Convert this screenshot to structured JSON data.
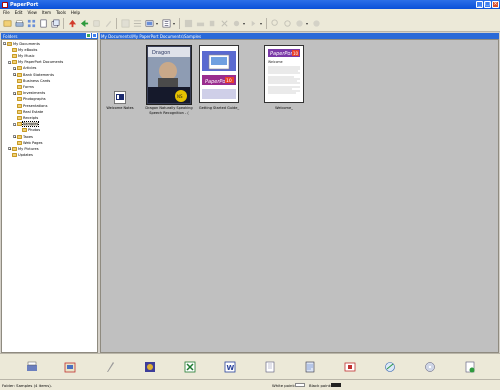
{
  "window": {
    "title": "PaperPort"
  },
  "menu": [
    "File",
    "Edit",
    "View",
    "Item",
    "Tools",
    "Help"
  ],
  "folders_panel": {
    "title": "Folders",
    "tree": [
      {
        "label": "My Documents",
        "expander": "−"
      },
      {
        "label": "My eBooks",
        "expander": ""
      },
      {
        "label": "My Music",
        "expander": ""
      },
      {
        "label": "My PaperPort Documents",
        "expander": "−"
      },
      {
        "label": "Articles",
        "expander": "+"
      },
      {
        "label": "Bank Statements",
        "expander": "+"
      },
      {
        "label": "Business Cards",
        "expander": ""
      },
      {
        "label": "Forms",
        "expander": ""
      },
      {
        "label": "Investments",
        "expander": "+"
      },
      {
        "label": "Photographs",
        "expander": ""
      },
      {
        "label": "Presentations",
        "expander": ""
      },
      {
        "label": "Real Estate",
        "expander": ""
      },
      {
        "label": "Receipts",
        "expander": ""
      },
      {
        "label": "Samples",
        "expander": "−"
      },
      {
        "label": "Photos",
        "expander": ""
      },
      {
        "label": "Taxes",
        "expander": "+"
      },
      {
        "label": "Web Pages",
        "expander": ""
      },
      {
        "label": "My Pictures",
        "expander": "+"
      },
      {
        "label": "Updates",
        "expander": ""
      }
    ],
    "selected": "Samples"
  },
  "path": "My Documents\\My PaperPort Documents\\Samples",
  "items": [
    {
      "caption": "Welcome Notes"
    },
    {
      "caption": "Dragon Naturally Speaking Speech Recognition - ("
    },
    {
      "caption": "Getting Started Guide_"
    },
    {
      "caption": "Welcome_"
    }
  ],
  "doc_text": {
    "brand": "PaperPort",
    "version": "10",
    "welcome": "Welcome",
    "dragon_brand": "Dragon",
    "ns_mark": "NS"
  },
  "send_to_apps": [
    {
      "icon": "scanner-app-icon"
    },
    {
      "icon": "fax-app-icon"
    },
    {
      "icon": "pencil-app-icon"
    },
    {
      "icon": "paint-app-icon"
    },
    {
      "icon": "excel-app-icon"
    },
    {
      "icon": "word-app-icon"
    },
    {
      "icon": "notepad-app-icon"
    },
    {
      "icon": "ocr-app-icon"
    },
    {
      "icon": "pdf-app-icon"
    },
    {
      "icon": "web-app-icon"
    },
    {
      "icon": "cd-app-icon"
    },
    {
      "icon": "add-app-icon"
    }
  ],
  "status": {
    "text": "Folder: Samples (4 items).",
    "white_point": "White point:",
    "black_point": "Black point:"
  },
  "colors": {
    "titlebar": "#0a50d8",
    "pane_header": "#2a6ad8",
    "workspace": "#c0c0c0",
    "chrome": "#ece9d8"
  }
}
